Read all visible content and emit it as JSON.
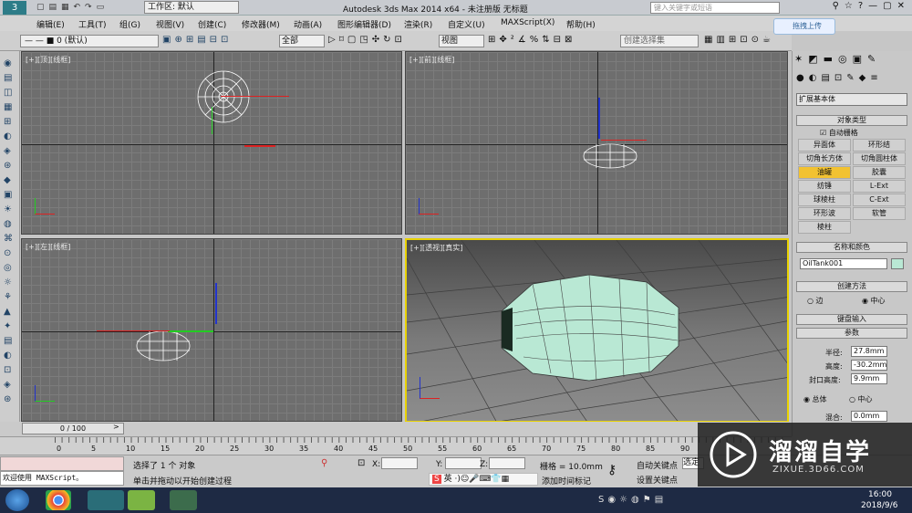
{
  "titlebar": {
    "workspace_label": "工作区: 默认",
    "title": "Autodesk 3ds Max  2014 x64   - 未注册版   无标题",
    "search_placeholder": "键入关键字或短语"
  },
  "menubar": {
    "items": [
      "编辑(E)",
      "工具(T)",
      "组(G)",
      "视图(V)",
      "创建(C)",
      "修改器(M)",
      "动画(A)",
      "图形编辑器(D)",
      "渲染(R)",
      "自定义(U)",
      "MAXScript(X)",
      "帮助(H)"
    ]
  },
  "toolbar": {
    "layer_value": "0 (默认)",
    "selection_filter": "全部",
    "coord_system": "视图",
    "named_selection_placeholder": "创建选择集",
    "upload_label": "拖拽上传"
  },
  "viewports": {
    "top": "[+][顶][线框]",
    "front": "[+][前][线框]",
    "left": "[+][左][线框]",
    "persp": "[+][透视][真实]"
  },
  "cmdpanel": {
    "dropdown": "扩展基本体",
    "object_type_header": "对象类型",
    "autogrid": "自动栅格",
    "buttons": [
      "异面体",
      "环形结",
      "切角长方体",
      "切角圆柱体",
      "油罐",
      "胶囊",
      "纺锤",
      "L-Ext",
      "球棱柱",
      "C-Ext",
      "环形波",
      "软管",
      "棱柱"
    ],
    "name_color_header": "名称和颜色",
    "object_name": "OilTank001",
    "creation_method_header": "创建方法",
    "method_edge": "边",
    "method_center": "中心",
    "keyboard_entry": "键盘输入",
    "params_header": "参数",
    "radius_label": "半径:",
    "radius_value": "27.8mm",
    "height_label": "高度:",
    "height_value": "-30.2mm",
    "cap_height_label": "封口高度:",
    "cap_height_value": "9.9mm",
    "overall": "总体",
    "center": "中心",
    "blend_label": "混合:",
    "blend_value": "0.0mm"
  },
  "timeline": {
    "frame": "0 / 100"
  },
  "ruler": {
    "ticks": [
      "0",
      "5",
      "10",
      "15",
      "20",
      "25",
      "30",
      "35",
      "40",
      "45",
      "50",
      "55",
      "60",
      "65",
      "70",
      "75",
      "80",
      "85",
      "90"
    ]
  },
  "status": {
    "maxscript": "欢迎使用 MAXScript。",
    "selected": "选择了 1 个 对象",
    "prompt": "单击并拖动以开始创建过程",
    "x_label": "X:",
    "y_label": "Y:",
    "z_label": "Z:",
    "grid": "栅格 = 10.0mm",
    "autokey": "自动关键点",
    "setkey": "设置关键点",
    "select": "选定",
    "add_time_tag": "添加时间标记"
  },
  "ime": {
    "label": "英"
  },
  "taskbar": {
    "time": "16:00",
    "date": "2018/9/6"
  },
  "watermark": {
    "brand": "溜溜自学",
    "url": "ZIXUE.3D66.COM"
  }
}
